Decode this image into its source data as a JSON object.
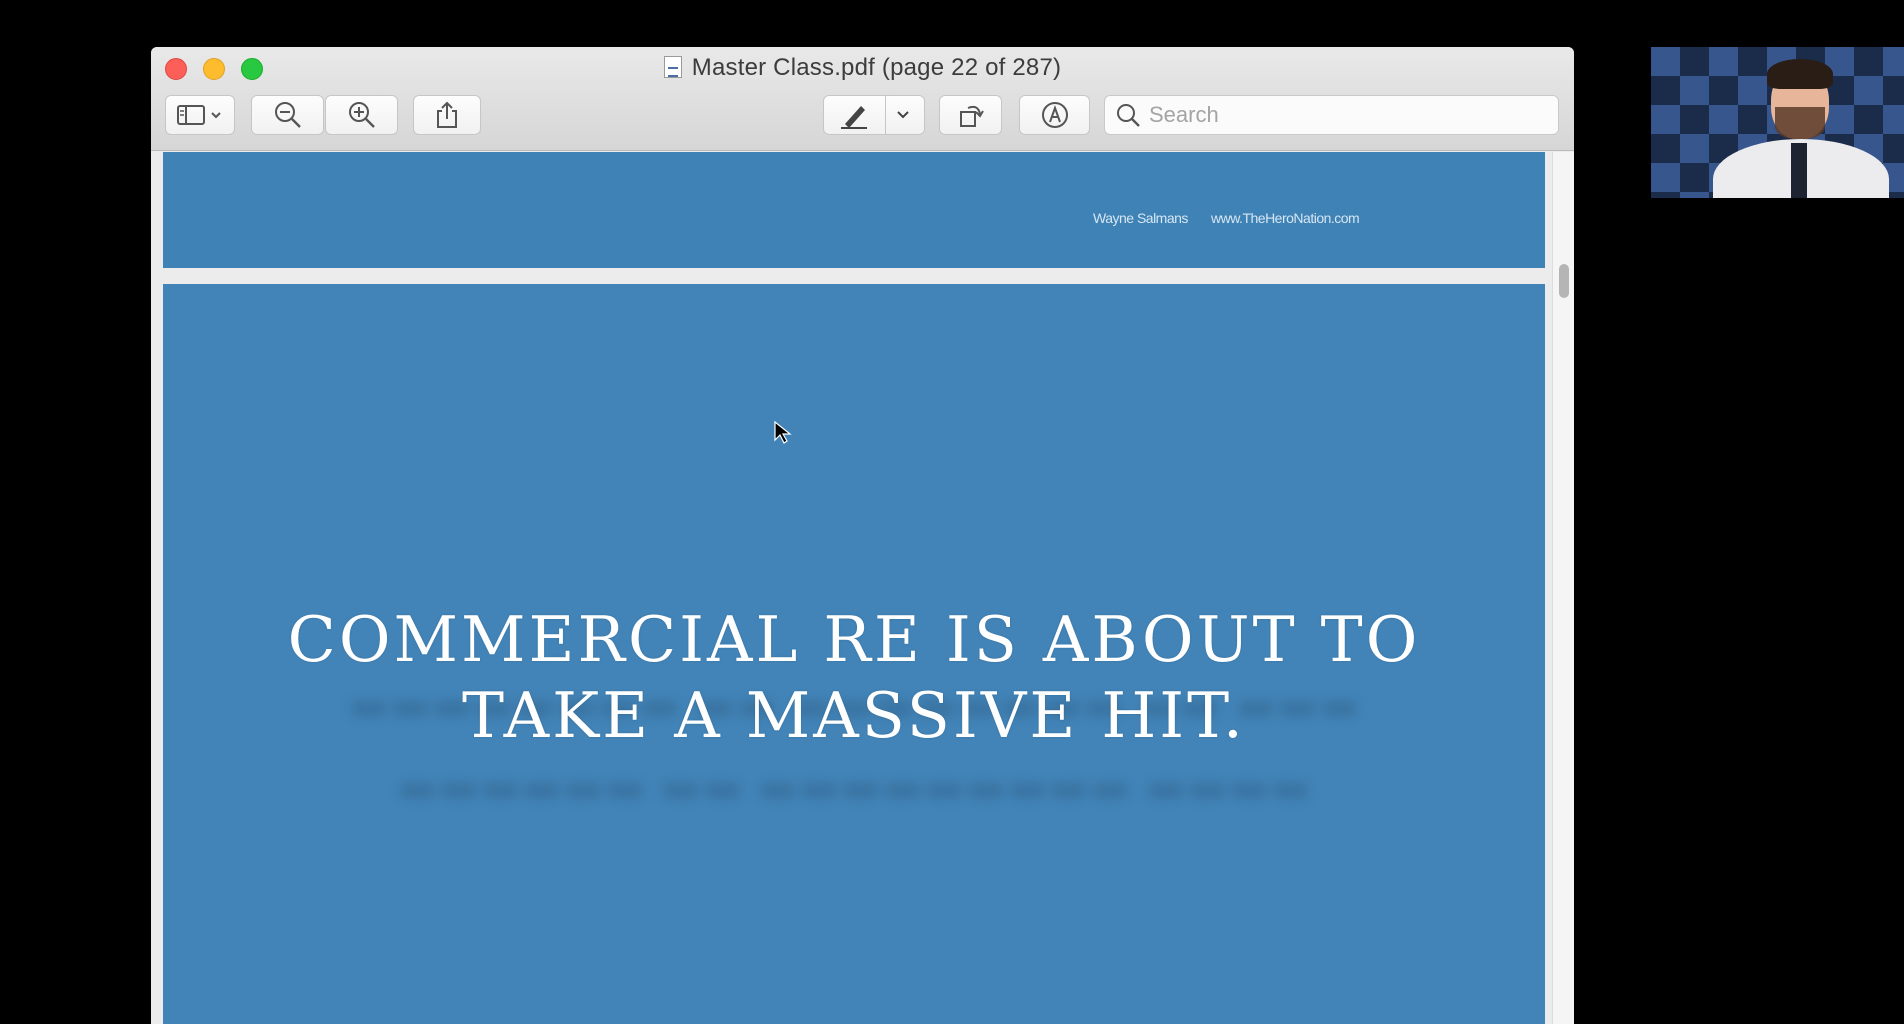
{
  "window": {
    "title": "Master Class.pdf (page 22 of 287)"
  },
  "toolbar": {
    "search_placeholder": "Search"
  },
  "document": {
    "footer_author": "Wayne Salmans",
    "footer_site": "www.TheHeroNation.com",
    "headline_line1": "COMMERCIAL RE IS ABOUT TO",
    "headline_line2": "TAKE A MASSIVE HIT."
  },
  "colors": {
    "page_background": "#4284b8",
    "window_chrome": "#e3e3e3"
  }
}
